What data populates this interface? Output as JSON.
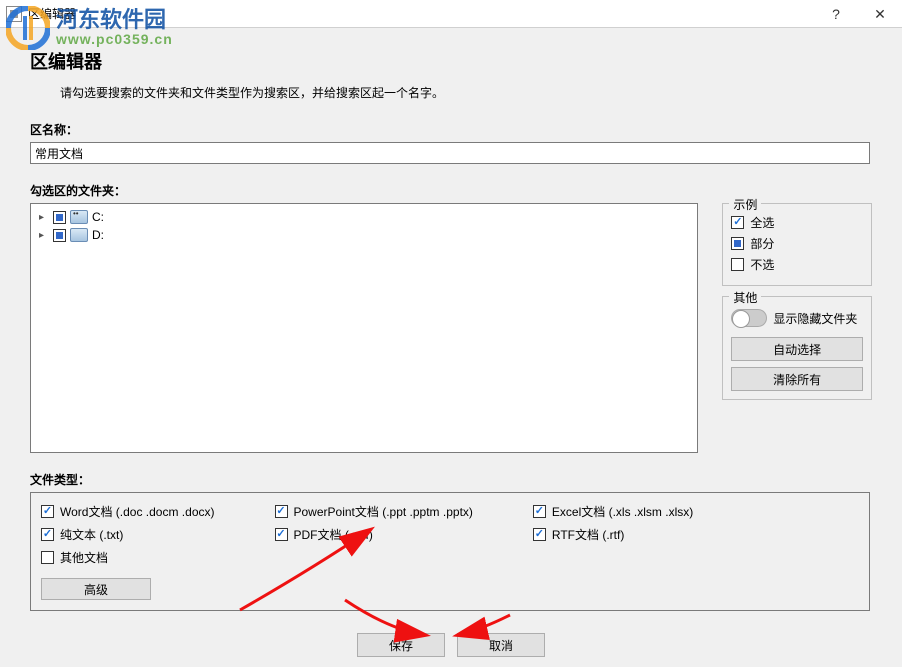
{
  "window": {
    "title": "区编辑器",
    "help": "?",
    "close": "✕"
  },
  "page": {
    "title": "区编辑器",
    "description": "请勾选要搜索的文件夹和文件类型作为搜索区，并给搜索区起一个名字。"
  },
  "zone_name": {
    "label": "区名称：",
    "value": "常用文档"
  },
  "folders": {
    "label": "勾选区的文件夹：",
    "drives": [
      {
        "label": "C:",
        "state": "partial"
      },
      {
        "label": "D:",
        "state": "partial"
      }
    ]
  },
  "legend": {
    "title": "示例",
    "all": "全选",
    "partial": "部分",
    "none": "不选"
  },
  "other": {
    "title": "其他",
    "show_hidden": "显示隐藏文件夹",
    "auto_select": "自动选择",
    "clear_all": "清除所有"
  },
  "filetypes": {
    "label": "文件类型：",
    "word": "Word文档 (.doc .docm .docx)",
    "plaintext": "纯文本 (.txt)",
    "other_docs": "其他文档",
    "ppt": "PowerPoint文档 (.ppt .pptm .pptx)",
    "pdf": "PDF文档 (.pdf)",
    "excel": "Excel文档 (.xls .xlsm .xlsx)",
    "rtf": "RTF文档 (.rtf)",
    "advanced": "高级"
  },
  "buttons": {
    "save": "保存",
    "cancel": "取消"
  },
  "watermark": {
    "text": "河东软件园",
    "url": "www.pc0359.cn"
  }
}
